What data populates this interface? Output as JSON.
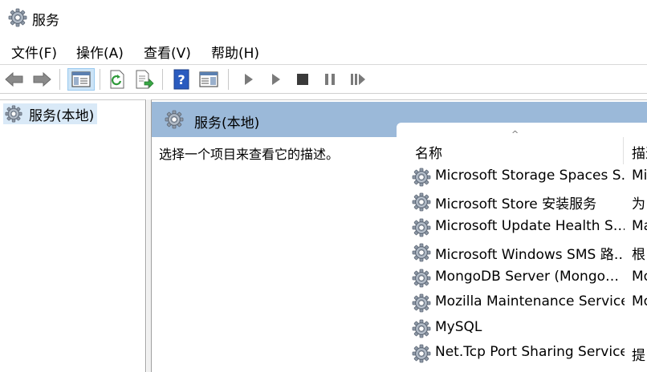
{
  "window": {
    "title": "服务",
    "icon": "gear-icon"
  },
  "menu": [
    {
      "label": "文件(F)"
    },
    {
      "label": "操作(A)"
    },
    {
      "label": "查看(V)"
    },
    {
      "label": "帮助(H)"
    }
  ],
  "toolbar": {
    "buttons": [
      {
        "icon": "back-arrow-icon"
      },
      {
        "icon": "forward-arrow-icon"
      },
      {
        "icon": "console-tree-icon",
        "pressed": true
      },
      {
        "icon": "refresh-icon"
      },
      {
        "icon": "export-list-icon"
      },
      {
        "icon": "help-icon"
      },
      {
        "icon": "properties-view-icon"
      },
      {
        "icon": "start-service-icon"
      },
      {
        "icon": "start-service-alt-icon"
      },
      {
        "icon": "stop-service-icon"
      },
      {
        "icon": "pause-service-icon"
      },
      {
        "icon": "resume-service-icon"
      }
    ]
  },
  "tree": {
    "root_label": "服务(本地)"
  },
  "pane": {
    "header_title": "服务(本地)",
    "description_prompt": "选择一个项目来查看它的描述。"
  },
  "table": {
    "columns": [
      {
        "label": "名称"
      },
      {
        "label": "描述"
      }
    ],
    "rows": [
      {
        "name": "Microsoft Storage Spaces S…",
        "desc": "Mi"
      },
      {
        "name": "Microsoft Store 安装服务",
        "desc": "为"
      },
      {
        "name": "Microsoft Update Health S…",
        "desc": "Ma"
      },
      {
        "name": "Microsoft Windows SMS 路…",
        "desc": "根"
      },
      {
        "name": "MongoDB Server (Mongo…",
        "desc": "Mo"
      },
      {
        "name": "Mozilla Maintenance Service",
        "desc": "Mo"
      },
      {
        "name": "MySQL",
        "desc": ""
      },
      {
        "name": "Net.Tcp Port Sharing Service",
        "desc": "提"
      }
    ]
  },
  "colors": {
    "header_blue": "#9bb9d9",
    "selection": "#d9e9f7",
    "help_blue": "#2a5bbf"
  }
}
